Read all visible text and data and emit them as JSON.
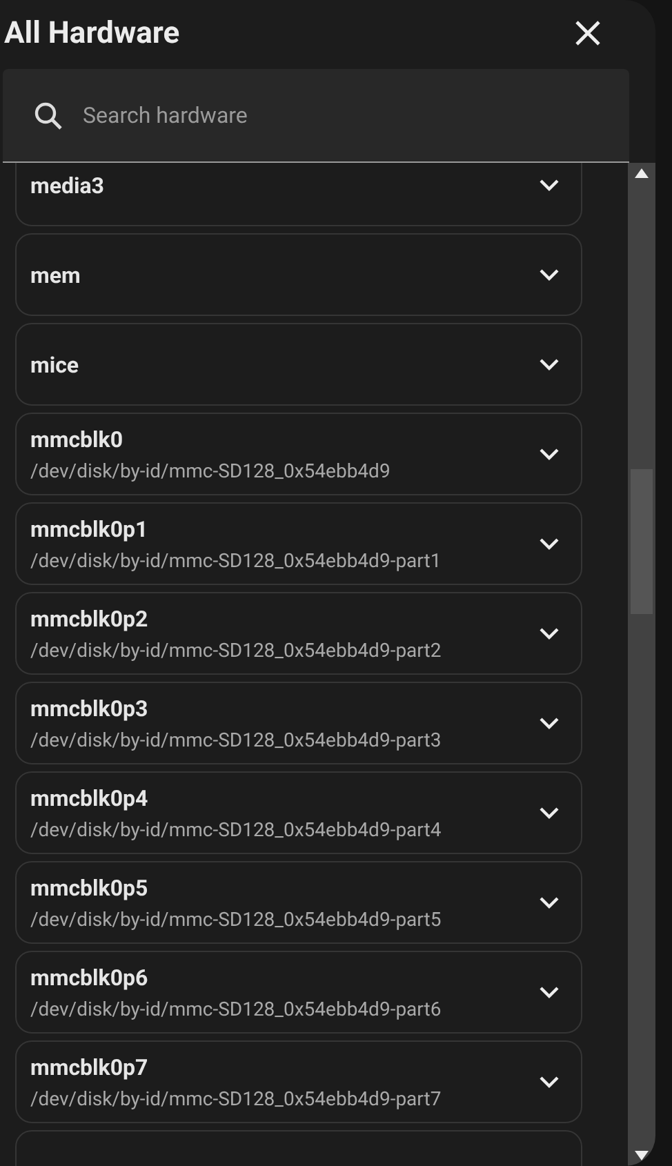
{
  "title": "All Hardware",
  "search": {
    "placeholder": "Search hardware"
  },
  "devices": [
    {
      "name": "media3"
    },
    {
      "name": "mem"
    },
    {
      "name": "mice"
    },
    {
      "name": "mmcblk0",
      "path": "/dev/disk/by-id/mmc-SD128_0x54ebb4d9"
    },
    {
      "name": "mmcblk0p1",
      "path": "/dev/disk/by-id/mmc-SD128_0x54ebb4d9-part1"
    },
    {
      "name": "mmcblk0p2",
      "path": "/dev/disk/by-id/mmc-SD128_0x54ebb4d9-part2"
    },
    {
      "name": "mmcblk0p3",
      "path": "/dev/disk/by-id/mmc-SD128_0x54ebb4d9-part3"
    },
    {
      "name": "mmcblk0p4",
      "path": "/dev/disk/by-id/mmc-SD128_0x54ebb4d9-part4"
    },
    {
      "name": "mmcblk0p5",
      "path": "/dev/disk/by-id/mmc-SD128_0x54ebb4d9-part5"
    },
    {
      "name": "mmcblk0p6",
      "path": "/dev/disk/by-id/mmc-SD128_0x54ebb4d9-part6"
    },
    {
      "name": "mmcblk0p7",
      "path": "/dev/disk/by-id/mmc-SD128_0x54ebb4d9-part7"
    }
  ]
}
